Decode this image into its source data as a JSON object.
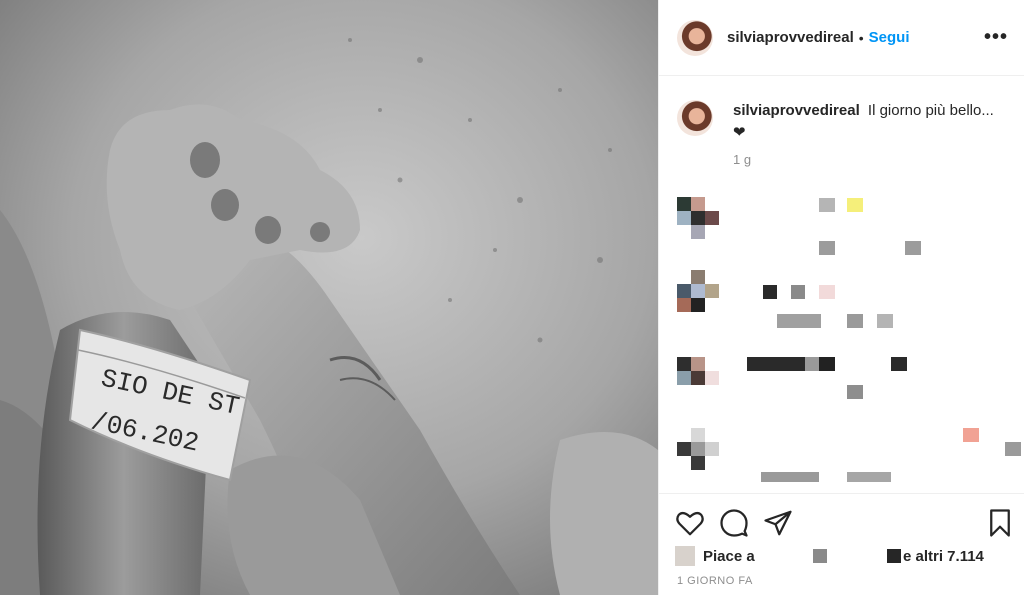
{
  "post": {
    "username": "silviaprovvedireal",
    "separator": "•",
    "follow_label": "Segui",
    "more_label": "•••",
    "caption_user": "silviaprovvedireal",
    "caption_text": "Il giorno più bello...",
    "caption_emoji": "❤",
    "caption_time": "1 g",
    "likes_prefix": "Piace a",
    "likes_suffix": "e altri 7.114",
    "timestamp": "1 GIORNO FA"
  },
  "photo": {
    "wristband_line1": "SIO DE ST",
    "wristband_line2": "/06.202"
  },
  "icons": {
    "like": "heart-icon",
    "comment": "comment-icon",
    "share": "paper-plane-icon",
    "save": "bookmark-icon"
  },
  "colors": {
    "follow": "#0095f6",
    "text": "#262626",
    "muted": "#8e8e8e"
  }
}
